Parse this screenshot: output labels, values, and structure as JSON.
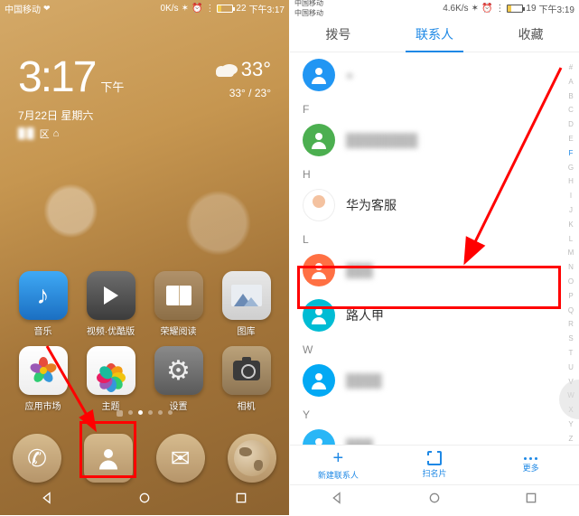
{
  "left": {
    "status": {
      "carrier": "中国移动",
      "speed": "0K/s",
      "batt": "22",
      "time": "下午3:17"
    },
    "clock": {
      "time": "3:17",
      "ampm": "下午",
      "date": "7月22日 星期六",
      "loc_suffix": "区"
    },
    "weather": {
      "temp": "33°",
      "range": "33° / 23°"
    },
    "apps": {
      "music": "音乐",
      "video": "视频·优酷版",
      "read": "荣耀阅读",
      "gallery": "图库",
      "market": "应用市场",
      "theme": "主题",
      "settings": "设置",
      "camera": "相机"
    }
  },
  "right": {
    "status": {
      "carrier1": "中国移动",
      "carrier2": "中国移动",
      "speed": "4.6K/s",
      "batt": "19",
      "time": "下午3:19"
    },
    "tabs": {
      "dial": "拨号",
      "contacts": "联系人",
      "fav": "收藏"
    },
    "sections": {
      "F": "F",
      "H": "H",
      "L": "L",
      "W": "W",
      "Y": "Y"
    },
    "contacts": {
      "top_blur": "●",
      "f_blur": "████████",
      "huawei": "华为客服",
      "l_blur": "███",
      "target": "路人甲",
      "w_blur": "████",
      "y_blur": "███",
      "bottom_blur": "█████████"
    },
    "bottom": {
      "new": "新建联系人",
      "scan": "扫名片",
      "more": "更多"
    },
    "index": [
      "#",
      "A",
      "B",
      "C",
      "D",
      "E",
      "F",
      "G",
      "H",
      "I",
      "J",
      "K",
      "L",
      "M",
      "N",
      "O",
      "P",
      "Q",
      "R",
      "S",
      "T",
      "U",
      "V",
      "W",
      "X",
      "Y",
      "Z"
    ]
  }
}
